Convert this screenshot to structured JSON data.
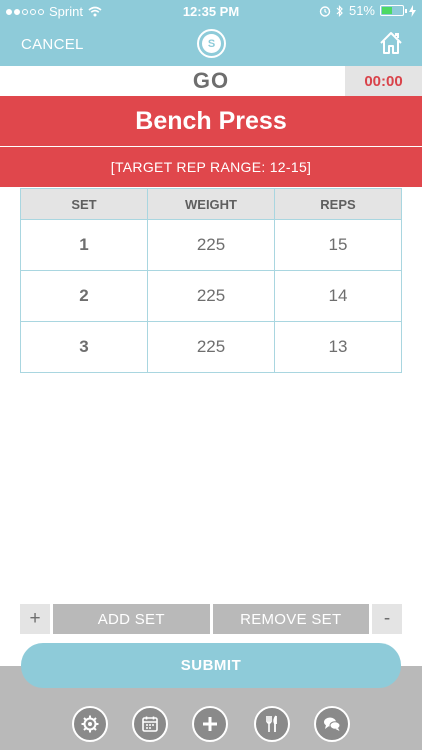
{
  "status": {
    "carrier": "Sprint",
    "time": "12:35 PM",
    "battery": "51%"
  },
  "nav": {
    "cancel_label": "CANCEL",
    "logo_letter": "S"
  },
  "header": {
    "go_label": "GO",
    "timer": "00:00"
  },
  "exercise": {
    "name": "Bench Press",
    "target": "[TARGET REP RANGE: 12-15]"
  },
  "table": {
    "headers": [
      "SET",
      "WEIGHT",
      "REPS"
    ],
    "rows": [
      {
        "set": "1",
        "weight": "225",
        "reps": "15"
      },
      {
        "set": "2",
        "weight": "225",
        "reps": "14"
      },
      {
        "set": "3",
        "weight": "225",
        "reps": "13"
      }
    ]
  },
  "controls": {
    "plus": "+",
    "add_set": "ADD SET",
    "remove_set": "REMOVE SET",
    "minus": "-",
    "submit": "SUBMIT"
  },
  "tabbar": {
    "icons": [
      "gear-icon",
      "calendar-icon",
      "plus-icon",
      "utensils-icon",
      "chat-icon"
    ]
  },
  "colors": {
    "accent": "#8ecbd9",
    "red": "#e0474c",
    "footer": "#b9b9b9"
  }
}
